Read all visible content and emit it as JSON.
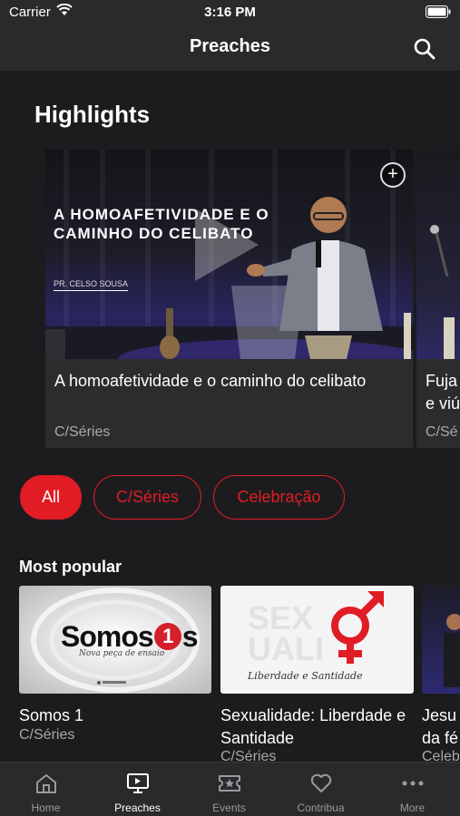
{
  "status_bar": {
    "carrier": "Carrier",
    "time": "3:16 PM"
  },
  "nav": {
    "title": "Preaches"
  },
  "highlights": {
    "title": "Highlights",
    "cards": [
      {
        "thumb_title": "A homoafetividade e o caminho do celibato",
        "thumb_pastor": "PR. CELSO SOUSA",
        "title": "A homoafetividade e o caminho do celibato",
        "category": "C/Séries"
      },
      {
        "title": "Fuja e viú",
        "category": "C/Sé"
      }
    ]
  },
  "filters": [
    {
      "label": "All",
      "active": true
    },
    {
      "label": "C/Séries",
      "active": false
    },
    {
      "label": "Celebração",
      "active": false
    }
  ],
  "most_popular": {
    "title": "Most popular",
    "items": [
      {
        "title": "Somos 1",
        "category": "C/Séries",
        "thumb_text": "Somos",
        "thumb_number": "1",
        "thumb_script": "Nova peça de ensaio"
      },
      {
        "title": "Sexualidade: Liberdade e Santidade",
        "category": "C/Séries",
        "thumb_script": "Liberdade e Santidade"
      },
      {
        "title": "Jesu da fé",
        "category": "Celeb"
      }
    ]
  },
  "tabs": [
    {
      "label": "Home",
      "icon": "home-icon"
    },
    {
      "label": "Preaches",
      "icon": "preaches-icon",
      "active": true
    },
    {
      "label": "Events",
      "icon": "events-icon"
    },
    {
      "label": "Contribua",
      "icon": "heart-icon"
    },
    {
      "label": "More",
      "icon": "more-icon"
    }
  ],
  "colors": {
    "accent": "#e11c24",
    "background": "#1c1c1e",
    "bar": "#2a2a2c"
  }
}
